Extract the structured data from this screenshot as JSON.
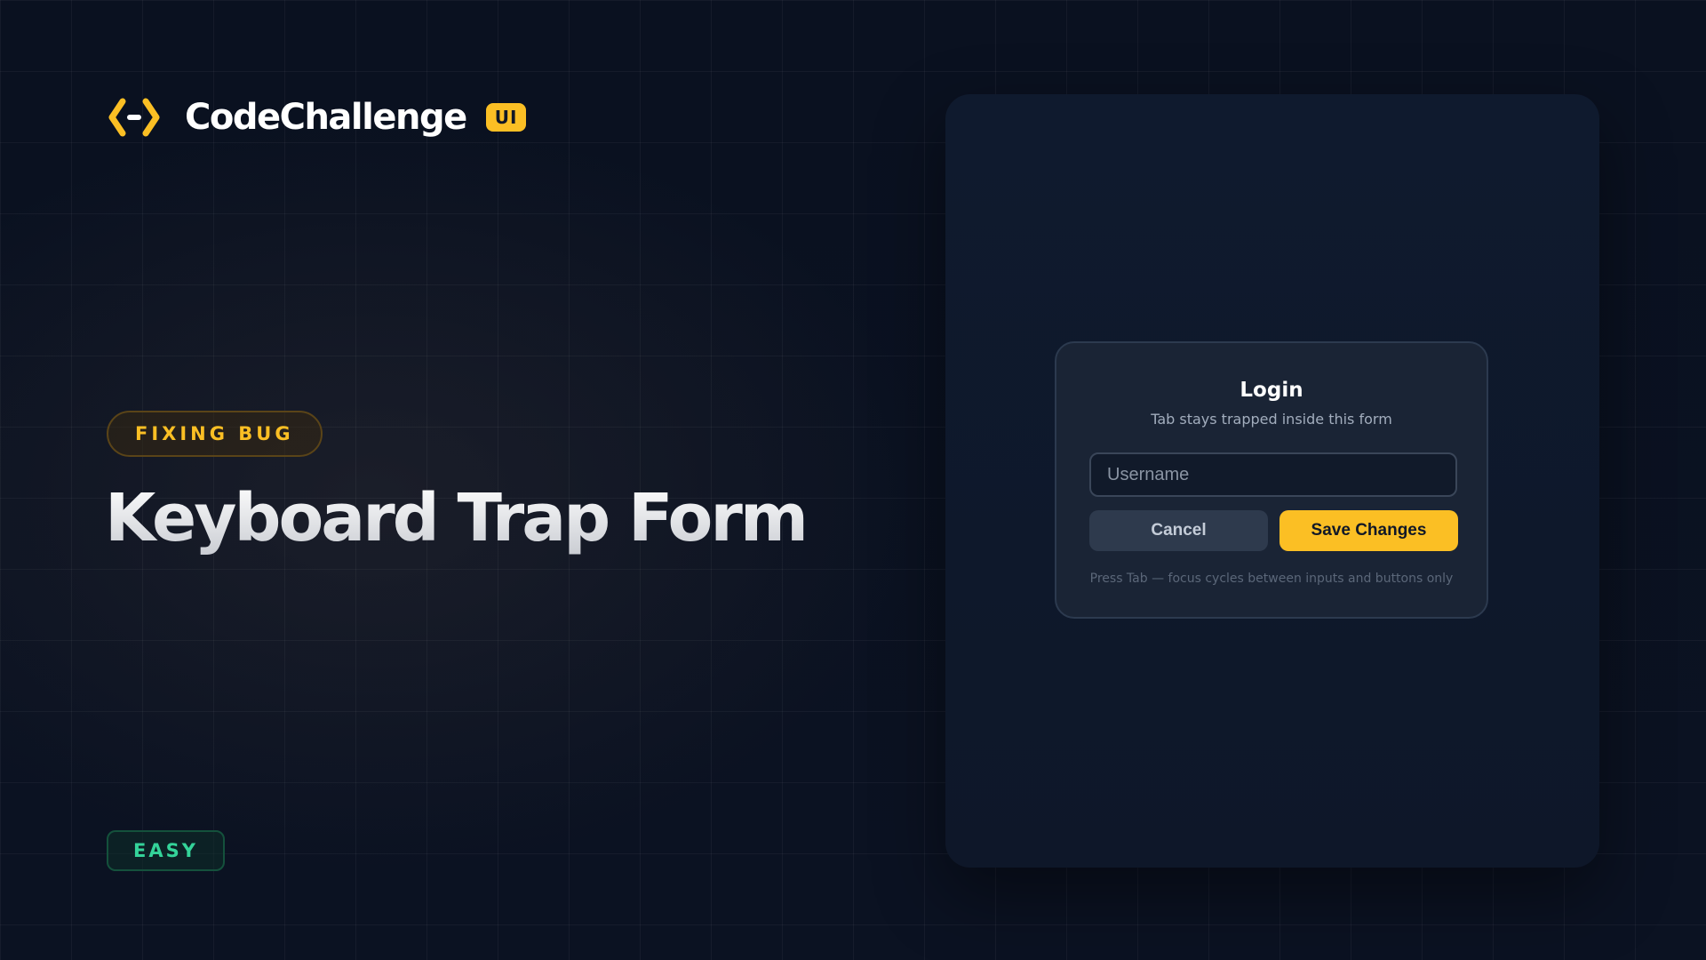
{
  "brand": {
    "name": "CodeChallenge",
    "badge": "UI",
    "logo_icon": "code-brackets-icon",
    "accent_color": "#fbbf24"
  },
  "challenge": {
    "category_tag": "FIXING BUG",
    "title": "Keyboard Trap Form",
    "difficulty": "EASY",
    "difficulty_color": "#34d399"
  },
  "modal": {
    "title": "Login",
    "subtitle": "Tab stays trapped inside this form",
    "username_placeholder": "Username",
    "cancel_label": "Cancel",
    "save_label": "Save Changes",
    "hint": "Press Tab — focus cycles between inputs and buttons only"
  }
}
